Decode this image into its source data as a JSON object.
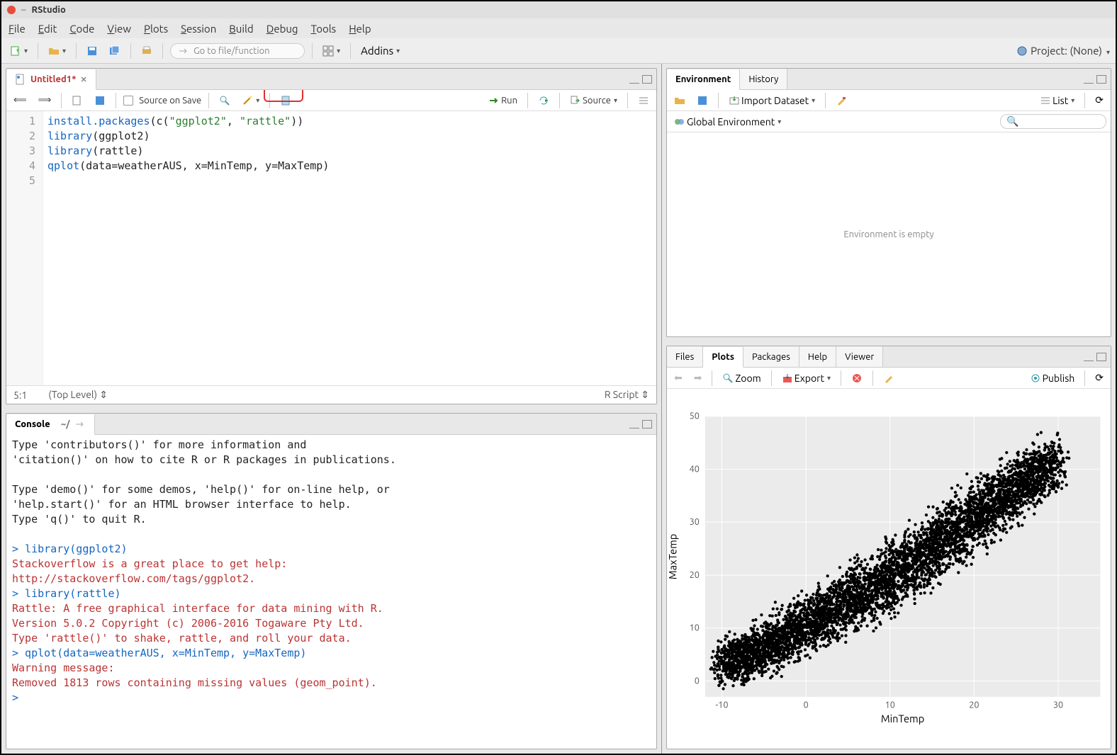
{
  "window": {
    "title": "RStudio"
  },
  "menu": [
    "File",
    "Edit",
    "Code",
    "View",
    "Plots",
    "Session",
    "Build",
    "Debug",
    "Tools",
    "Help"
  ],
  "maintb": {
    "goto_placeholder": "Go to file/function",
    "addins": "Addins",
    "project": "Project: (None)"
  },
  "source": {
    "tab_name": "Untitled1*",
    "source_on_save": "Source on Save",
    "run": "Run",
    "source_btn": "Source",
    "lines": [
      1,
      2,
      3,
      4,
      5
    ],
    "code": {
      "l1a": "install.packages",
      "l1b": "(c(",
      "l1c": "\"ggplot2\"",
      "l1d": ", ",
      "l1e": "\"rattle\"",
      "l1f": "))",
      "l2a": "library",
      "l2b": "(ggplot2)",
      "l3a": "library",
      "l3b": "(rattle)",
      "l4a": "qplot",
      "l4b": "(data=weatherAUS, x=MinTemp, y=MaxTemp)"
    },
    "status_pos": "5:1",
    "status_scope": "(Top Level)",
    "status_lang": "R Script"
  },
  "console": {
    "title": "Console",
    "path": "~/",
    "t1": "Type 'contributors()' for more information and",
    "t2": "'citation()' on how to cite R or R packages in publications.",
    "t3": "Type 'demo()' for some demos, 'help()' for on-line help, or",
    "t4": "'help.start()' for an HTML browser interface to help.",
    "t5": "Type 'q()' to quit R.",
    "p1": "> library(ggplot2)",
    "m1": "Stackoverflow is a great place to get help:",
    "m2": "http://stackoverflow.com/tags/ggplot2.",
    "p2": "> library(rattle)",
    "m3": "Rattle: A free graphical interface for data mining with R.",
    "m4": "Version 5.0.2 Copyright (c) 2006-2016 Togaware Pty Ltd.",
    "m5": "Type 'rattle()' to shake, rattle, and roll your data.",
    "p3": "> qplot(data=weatherAUS, x=MinTemp, y=MaxTemp)",
    "m6": "Warning message:",
    "m7": "Removed 1813 rows containing missing values (geom_point).",
    "p4": "> "
  },
  "env": {
    "tab1": "Environment",
    "tab2": "History",
    "import": "Import Dataset",
    "list": "List",
    "scope": "Global Environment",
    "empty": "Environment is empty"
  },
  "plots": {
    "tabs": [
      "Files",
      "Plots",
      "Packages",
      "Help",
      "Viewer"
    ],
    "zoom": "Zoom",
    "export": "Export",
    "publish": "Publish"
  },
  "chart_data": {
    "type": "scatter",
    "title": "",
    "xlabel": "MinTemp",
    "ylabel": "MaxTemp",
    "xlim": [
      -12,
      35
    ],
    "ylim": [
      -3,
      50
    ],
    "xticks": [
      -10,
      0,
      10,
      20,
      30
    ],
    "yticks": [
      0,
      10,
      20,
      30,
      40,
      50
    ],
    "grid": true,
    "note": "Dense scatter cloud, ~positively correlated; 1813 rows with missing values removed.",
    "series": [
      {
        "name": "weatherAUS",
        "approx_band": [
          [
            -10,
            -3,
            9
          ],
          [
            -5,
            -1,
            13
          ],
          [
            0,
            3,
            18
          ],
          [
            5,
            7,
            23
          ],
          [
            10,
            11,
            28
          ],
          [
            15,
            16,
            34
          ],
          [
            20,
            22,
            40
          ],
          [
            25,
            28,
            45
          ],
          [
            30,
            35,
            48
          ]
        ]
      }
    ]
  }
}
